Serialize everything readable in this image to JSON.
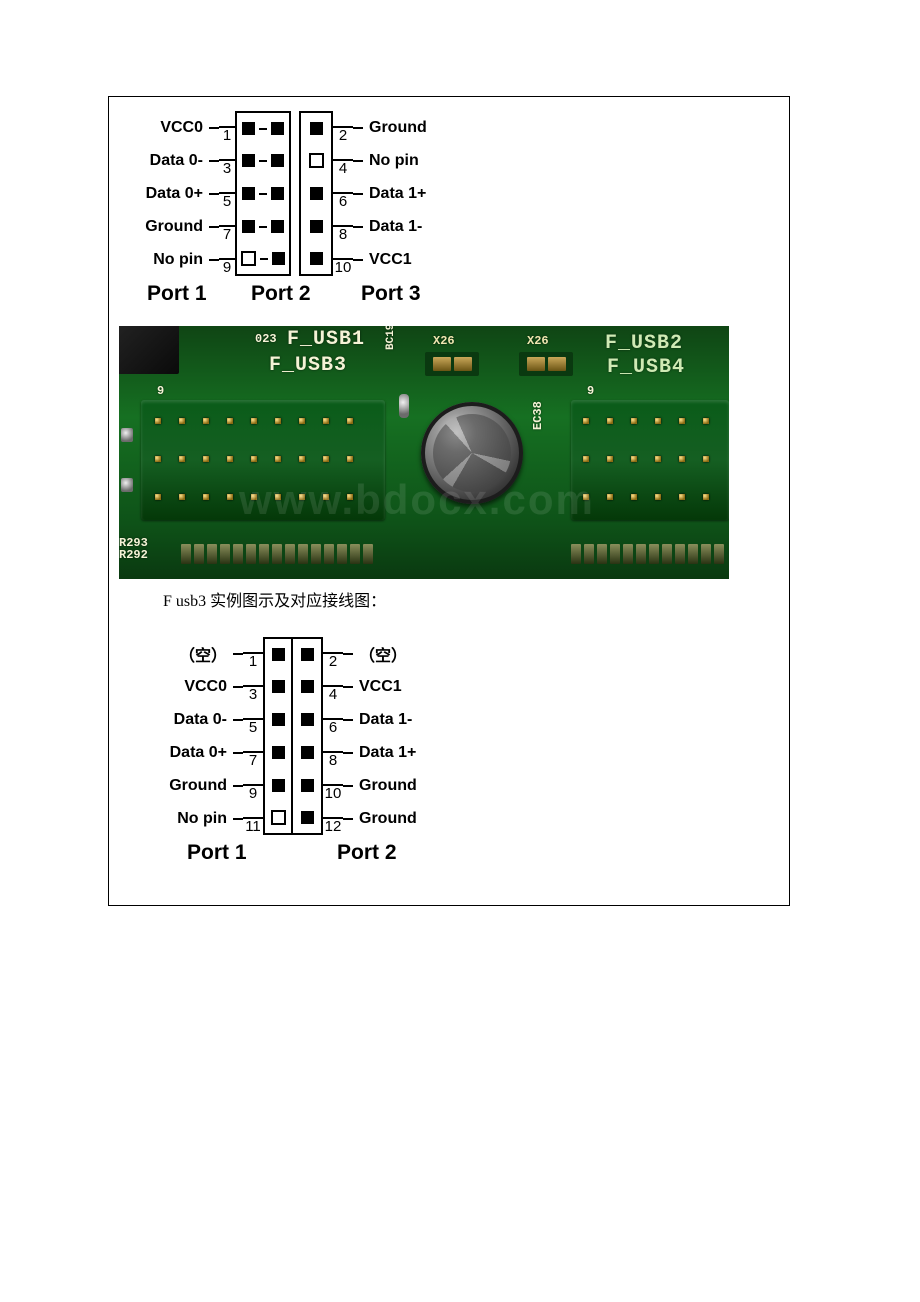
{
  "diagram1": {
    "rows": [
      {
        "left_label": "VCC0",
        "left_num": "1",
        "col1": [
          "fill",
          "fill"
        ],
        "col2": "fill",
        "right_num": "2",
        "right_label": "Ground"
      },
      {
        "left_label": "Data 0-",
        "left_num": "3",
        "col1": [
          "fill",
          "fill"
        ],
        "col2": "empty",
        "right_num": "4",
        "right_label": "No pin"
      },
      {
        "left_label": "Data 0+",
        "left_num": "5",
        "col1": [
          "fill",
          "fill"
        ],
        "col2": "fill",
        "right_num": "6",
        "right_label": "Data 1+"
      },
      {
        "left_label": "Ground",
        "left_num": "7",
        "col1": [
          "fill",
          "fill"
        ],
        "col2": "fill",
        "right_num": "8",
        "right_label": "Data 1-"
      },
      {
        "left_label": "No pin",
        "left_num": "9",
        "col1": [
          "empty",
          "fill"
        ],
        "col2": "fill",
        "right_num": "10",
        "right_label": "VCC1"
      }
    ],
    "ports": {
      "p1": "Port 1",
      "p2": "Port 2",
      "p3": "Port 3"
    }
  },
  "pcb": {
    "silks": {
      "s023": "023",
      "fusb1": "F_USB1",
      "fusb3": "F_USB3",
      "fusb2": "F_USB2",
      "fusb4": "F_USB4",
      "r293": "R293",
      "r292": "R292",
      "nine_a": "9",
      "nine_b": "9",
      "ec38": "EC38",
      "bc19": "BC19",
      "x26a": "X26",
      "x26b": "X26"
    },
    "watermark": "www.bdocx.com"
  },
  "caption": "F usb3 实例图示及对应接线图：",
  "diagram2": {
    "rows": [
      {
        "left_label": "（空）",
        "left_num": "1",
        "p1": "fill",
        "p2": "fill",
        "right_num": "2",
        "right_label": "（空）"
      },
      {
        "left_label": "VCC0",
        "left_num": "3",
        "p1": "fill",
        "p2": "fill",
        "right_num": "4",
        "right_label": "VCC1"
      },
      {
        "left_label": "Data 0-",
        "left_num": "5",
        "p1": "fill",
        "p2": "fill",
        "right_num": "6",
        "right_label": "Data 1-"
      },
      {
        "left_label": "Data 0+",
        "left_num": "7",
        "p1": "fill",
        "p2": "fill",
        "right_num": "8",
        "right_label": "Data 1+"
      },
      {
        "left_label": "Ground",
        "left_num": "9",
        "p1": "fill",
        "p2": "fill",
        "right_num": "10",
        "right_label": "Ground"
      },
      {
        "left_label": "No pin",
        "left_num": "11",
        "p1": "empty",
        "p2": "fill",
        "right_num": "12",
        "right_label": "Ground"
      }
    ],
    "ports": {
      "p1": "Port 1",
      "p2": "Port 2"
    }
  }
}
